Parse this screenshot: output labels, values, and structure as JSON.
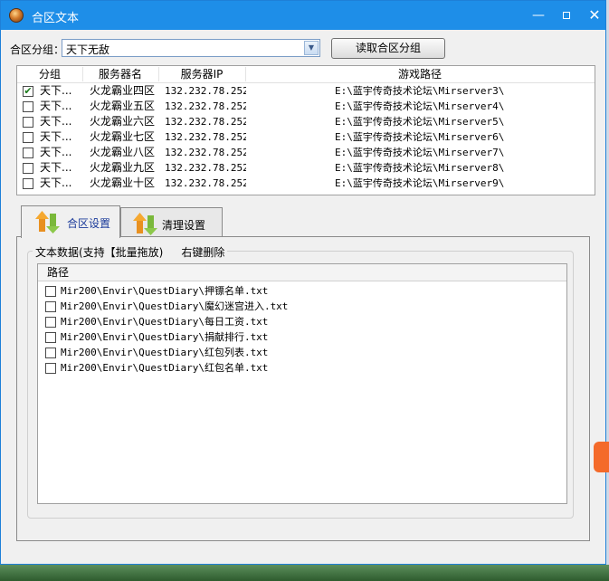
{
  "window": {
    "title": "合区文本"
  },
  "group_select": {
    "label": "合区分组：",
    "value": "天下无敌"
  },
  "read_button": {
    "label": "读取合区分组"
  },
  "server_list": {
    "columns": [
      "分组",
      "服务器名",
      "服务器IP",
      "游戏路径"
    ],
    "rows": [
      {
        "checked": true,
        "group": "天下...",
        "name": "火龙霸业四区",
        "ip": "132.232.78.252",
        "path": "E:\\蓝宇传奇技术论坛\\Mirserver3\\"
      },
      {
        "checked": false,
        "group": "天下...",
        "name": "火龙霸业五区",
        "ip": "132.232.78.252",
        "path": "E:\\蓝宇传奇技术论坛\\Mirserver4\\"
      },
      {
        "checked": false,
        "group": "天下...",
        "name": "火龙霸业六区",
        "ip": "132.232.78.252",
        "path": "E:\\蓝宇传奇技术论坛\\Mirserver5\\"
      },
      {
        "checked": false,
        "group": "天下...",
        "name": "火龙霸业七区",
        "ip": "132.232.78.252",
        "path": "E:\\蓝宇传奇技术论坛\\Mirserver6\\"
      },
      {
        "checked": false,
        "group": "天下...",
        "name": "火龙霸业八区",
        "ip": "132.232.78.252",
        "path": "E:\\蓝宇传奇技术论坛\\Mirserver7\\"
      },
      {
        "checked": false,
        "group": "天下...",
        "name": "火龙霸业九区",
        "ip": "132.232.78.252",
        "path": "E:\\蓝宇传奇技术论坛\\Mirserver8\\"
      },
      {
        "checked": false,
        "group": "天下...",
        "name": "火龙霸业十区",
        "ip": "132.232.78.252",
        "path": "E:\\蓝宇传奇技术论坛\\Mirserver9\\"
      }
    ]
  },
  "tabs": [
    {
      "label": "合区设置",
      "active": true
    },
    {
      "label": "清理设置",
      "active": false
    }
  ],
  "text_data": {
    "title": "文本数据(支持【批量拖放)",
    "hint": "右键删除",
    "column": "路径",
    "files": [
      "Mir200\\Envir\\QuestDiary\\押镖名单.txt",
      "Mir200\\Envir\\QuestDiary\\魔幻迷宫进入.txt",
      "Mir200\\Envir\\QuestDiary\\每日工资.txt",
      "Mir200\\Envir\\QuestDiary\\捐献排行.txt",
      "Mir200\\Envir\\QuestDiary\\红包列表.txt",
      "Mir200\\Envir\\QuestDiary\\红包名单.txt"
    ]
  }
}
